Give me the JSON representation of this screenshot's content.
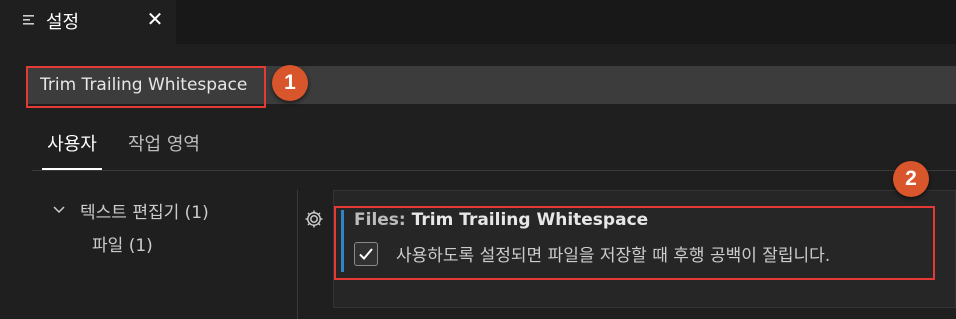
{
  "tab": {
    "title": "설정",
    "icon": "settings-list-icon",
    "close_icon": "close-icon",
    "close_label": "✕"
  },
  "search": {
    "value": "Trim Trailing Whitespace",
    "placeholder": ""
  },
  "callouts": [
    {
      "label": "1"
    },
    {
      "label": "2"
    }
  ],
  "scope_tabs": [
    {
      "label": "사용자",
      "active": true
    },
    {
      "label": "작업 영역",
      "active": false
    }
  ],
  "tree": {
    "items": [
      {
        "label": "텍스트 편집기",
        "count": "(1)",
        "expanded": true
      },
      {
        "label": "파일",
        "count": "(1)"
      }
    ]
  },
  "setting": {
    "category": "Files: ",
    "name": "Trim Trailing Whitespace",
    "checked": true,
    "description": "사용하도록 설정되면 파일을 저장할 때 후행 공백이 잘립니다."
  },
  "colors": {
    "accent": "#2f84c7",
    "callout_badge": "#d9552b",
    "callout_border": "#e53935"
  }
}
